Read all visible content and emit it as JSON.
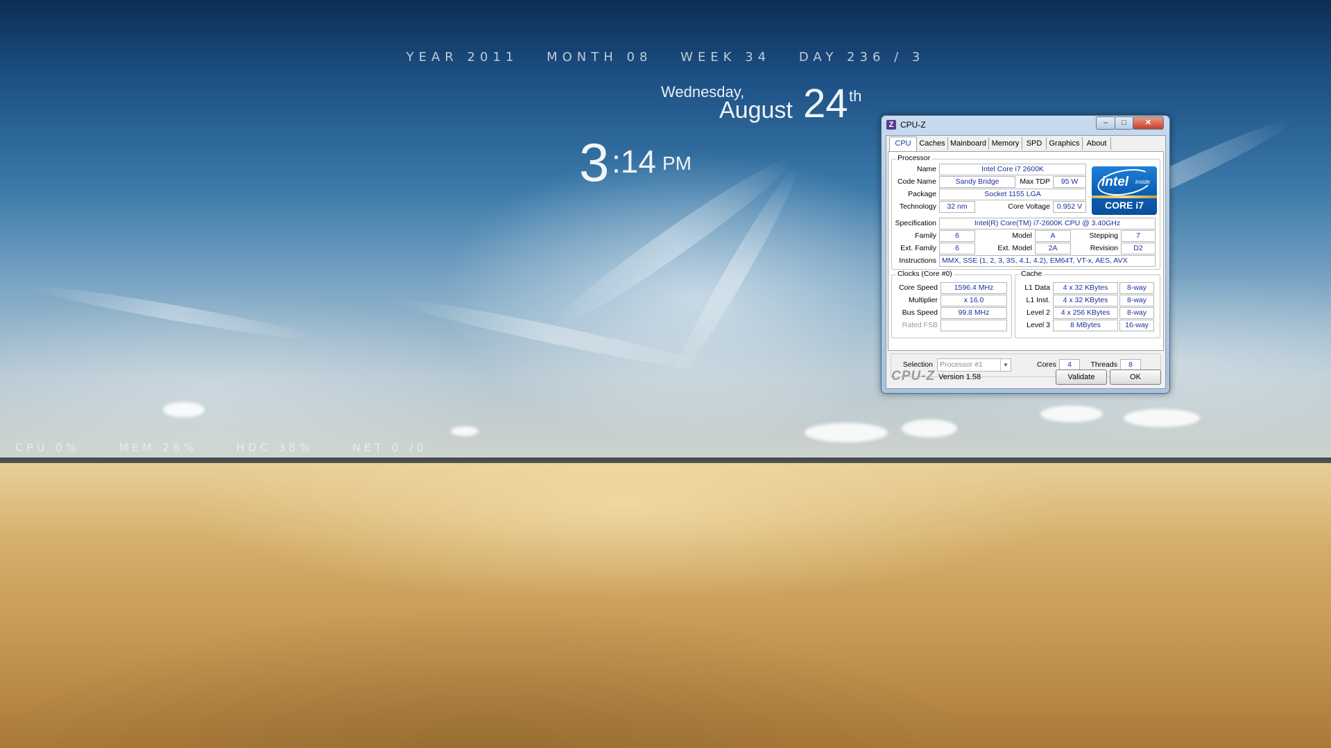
{
  "desktop": {
    "dateline": {
      "year": "YEAR 2011",
      "month": "MONTH 08",
      "week": "WEEK 34",
      "day": "DAY 236 / 3"
    },
    "date": {
      "weekday": "Wednesday,",
      "month": "August",
      "day": "24",
      "suffix": "th"
    },
    "clock": {
      "hour": "3",
      "minute": ":14",
      "ampm": "PM"
    },
    "stats": {
      "cpu": "CPU 0%",
      "mem": "MEM 28%",
      "hdc": "HDC 38%",
      "net": "NET 0 /0"
    }
  },
  "window": {
    "title": "CPU-Z",
    "controls": {
      "minimize": "–",
      "maximize": "□",
      "close": "✕"
    },
    "tabs": [
      "CPU",
      "Caches",
      "Mainboard",
      "Memory",
      "SPD",
      "Graphics",
      "About"
    ],
    "active_tab": "CPU",
    "processor": {
      "group_label": "Processor",
      "name_label": "Name",
      "name": "Intel Core i7 2600K",
      "codename_label": "Code Name",
      "codename": "Sandy Bridge",
      "maxtdp_label": "Max TDP",
      "maxtdp": "95 W",
      "package_label": "Package",
      "package": "Socket 1155 LGA",
      "technology_label": "Technology",
      "technology": "32 nm",
      "voltage_label": "Core Voltage",
      "voltage": "0.952 V",
      "spec_label": "Specification",
      "spec": "Intel(R) Core(TM) i7-2600K CPU @ 3.40GHz",
      "family_label": "Family",
      "family": "6",
      "model_label": "Model",
      "model": "A",
      "stepping_label": "Stepping",
      "stepping": "7",
      "extfamily_label": "Ext. Family",
      "extfamily": "6",
      "extmodel_label": "Ext. Model",
      "extmodel": "2A",
      "revision_label": "Revision",
      "revision": "D2",
      "instructions_label": "Instructions",
      "instructions": "MMX, SSE (1, 2, 3, 3S, 4.1, 4.2), EM64T, VT-x, AES, AVX"
    },
    "logo": {
      "brand": "intel",
      "inside": "inside",
      "line": "CORE i7"
    },
    "clocks": {
      "group_label": "Clocks (Core #0)",
      "corespeed_label": "Core Speed",
      "corespeed": "1596.4 MHz",
      "multiplier_label": "Multiplier",
      "multiplier": "x 16.0",
      "busspeed_label": "Bus Speed",
      "busspeed": "99.8 MHz",
      "ratedfsb_label": "Rated FSB",
      "ratedfsb": ""
    },
    "cache": {
      "group_label": "Cache",
      "rows": [
        {
          "label": "L1 Data",
          "size": "4 x 32 KBytes",
          "assoc": "8-way"
        },
        {
          "label": "L1 Inst.",
          "size": "4 x 32 KBytes",
          "assoc": "8-way"
        },
        {
          "label": "Level 2",
          "size": "4 x 256 KBytes",
          "assoc": "8-way"
        },
        {
          "label": "Level 3",
          "size": "8 MBytes",
          "assoc": "16-way"
        }
      ]
    },
    "selection": {
      "label": "Selection",
      "value": "Processor #1",
      "cores_label": "Cores",
      "cores": "4",
      "threads_label": "Threads",
      "threads": "8"
    },
    "footer": {
      "logo": "CPU-Z",
      "version": "Version 1.58",
      "validate": "Validate",
      "ok": "OK"
    }
  }
}
